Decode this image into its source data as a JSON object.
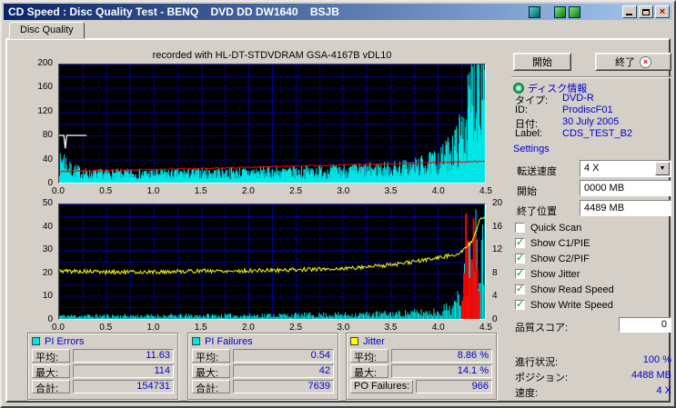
{
  "window": {
    "title": "CD Speed : Disc Quality Test - BENQ    DVD DD DW1640    BSJB"
  },
  "tabs": [
    {
      "label": "Disc Quality"
    }
  ],
  "buttons": {
    "start": "開始",
    "stop": "終了"
  },
  "disc_info": {
    "header": "ディスク情報",
    "rows": [
      {
        "label": "タイプ:",
        "value": "DVD-R"
      },
      {
        "label": "ID:",
        "value": "ProdiscF01"
      },
      {
        "label": "日付:",
        "value": "30 July 2005"
      },
      {
        "label": "Label:",
        "value": "CDS_TEST_B2"
      }
    ]
  },
  "settings": {
    "header": "Settings",
    "speed_label": "転送速度",
    "speed_value": "4 X",
    "start_label": "開始",
    "start_value": "0000 MB",
    "end_label": "終了位置",
    "end_value": "4489 MB",
    "checkboxes": [
      {
        "label": "Quick Scan",
        "checked": false
      },
      {
        "label": "Show C1/PIE",
        "checked": true
      },
      {
        "label": "Show C2/PIF",
        "checked": true
      },
      {
        "label": "Show Jitter",
        "checked": true
      },
      {
        "label": "Show Read Speed",
        "checked": true
      },
      {
        "label": "Show Write Speed",
        "checked": true
      }
    ]
  },
  "quality": {
    "label": "品質スコア:",
    "value": "0"
  },
  "status": [
    {
      "label": "進行状況:",
      "value": "100 %"
    },
    {
      "label": "ポジション:",
      "value": "4488 MB"
    },
    {
      "label": "速度:",
      "value": "4 X"
    }
  ],
  "stats_boxes": [
    {
      "title": "PI Errors",
      "swatch": "#00e6e6",
      "rows": [
        {
          "label": "平均:",
          "value": "11.63"
        },
        {
          "label": "最大:",
          "value": "114"
        },
        {
          "label": "合計:",
          "value": "154731"
        }
      ]
    },
    {
      "title": "PI Failures",
      "swatch": "#00e6e6",
      "rows": [
        {
          "label": "平均:",
          "value": "0.54"
        },
        {
          "label": "最大:",
          "value": "42"
        },
        {
          "label": "合計:",
          "value": "7639"
        }
      ]
    },
    {
      "title": "Jitter",
      "swatch": "#ffff00",
      "rows": [
        {
          "label": "平均:",
          "value": "8.86 %"
        },
        {
          "label": "最大:",
          "value": "14.1 %"
        },
        {
          "label": "PO Failures:",
          "value": "966"
        }
      ]
    }
  ],
  "colors": {
    "titlebar_left": "#0a246a",
    "titlebar_right": "#a6caf0",
    "window_bg": "#d4d0c8",
    "plot_bg": "#000000",
    "grid": "#00008c",
    "value_text": "#0000cc",
    "check": "#00a000"
  },
  "chart_data": [
    {
      "type": "area",
      "title": "recorded with HL-DT-STDVDRAM GSA-4167B vDL10",
      "x_range": [
        0,
        4.5
      ],
      "y_range": [
        0,
        200
      ],
      "x_ticks": [
        "0.0",
        "0.5",
        "1.0",
        "1.5",
        "2.0",
        "2.5",
        "3.0",
        "3.5",
        "4.0",
        "4.5"
      ],
      "y_ticks": [
        "200",
        "160",
        "120",
        "80",
        "40",
        "0"
      ],
      "grid_x_step": 0.25,
      "grid_y_step": 20,
      "series": [
        {
          "name": "PI Errors",
          "color": "#00e6e6",
          "style": "spikes",
          "seed": 7,
          "step": 0.006,
          "envelope": [
            [
              0,
              25
            ],
            [
              0.04,
              40
            ],
            [
              0.1,
              22
            ],
            [
              0.3,
              14
            ],
            [
              1,
              14
            ],
            [
              1.5,
              15
            ],
            [
              2,
              16
            ],
            [
              2.5,
              17
            ],
            [
              3,
              19
            ],
            [
              3.4,
              21
            ],
            [
              3.7,
              24
            ],
            [
              3.9,
              30
            ],
            [
              4.05,
              38
            ],
            [
              4.2,
              60
            ],
            [
              4.3,
              95
            ],
            [
              4.38,
              150
            ],
            [
              4.43,
              195
            ],
            [
              4.45,
              195
            ]
          ]
        },
        {
          "name": "Write Speed",
          "color": "#ff0000",
          "style": "noisyline",
          "seed": 3,
          "step": 0.01,
          "noise": 1.2,
          "envelope": [
            [
              0,
              19
            ],
            [
              1,
              22
            ],
            [
              2,
              26
            ],
            [
              3,
              30
            ],
            [
              4,
              34
            ],
            [
              4.45,
              36
            ]
          ]
        },
        {
          "name": "Read Speed",
          "color": "#ffffff",
          "style": "line",
          "points": [
            [
              0,
              80
            ],
            [
              0.05,
              80
            ],
            [
              0.065,
              58
            ],
            [
              0.08,
              80
            ],
            [
              0.29,
              80
            ]
          ]
        }
      ]
    },
    {
      "type": "line",
      "x_range": [
        0,
        4.5
      ],
      "y_range": [
        0,
        50
      ],
      "y2_range": [
        0,
        20
      ],
      "x_ticks": [
        "0.0",
        "0.5",
        "1.0",
        "1.5",
        "2.0",
        "2.5",
        "3.0",
        "3.5",
        "4.0",
        "4.5"
      ],
      "y_ticks": [
        "50",
        "40",
        "30",
        "20",
        "10",
        "0"
      ],
      "y2_ticks": [
        "20",
        "16",
        "12",
        "8",
        "4",
        "0"
      ],
      "grid_x_step": 0.25,
      "grid_y_step": 5,
      "series": [
        {
          "name": "PI Failures",
          "color": "#00e6e6",
          "style": "spikes",
          "seed": 11,
          "step": 0.012,
          "envelope": [
            [
              0,
              1.3
            ],
            [
              1,
              1.3
            ],
            [
              2,
              1.5
            ],
            [
              3,
              1.8
            ],
            [
              3.5,
              2.2
            ],
            [
              4,
              3
            ],
            [
              4.2,
              6
            ],
            [
              4.3,
              18
            ],
            [
              4.38,
              30
            ],
            [
              4.45,
              40
            ]
          ]
        },
        {
          "name": "PO Failures",
          "color": "#ff0000",
          "style": "spikelist",
          "spikes": [
            [
              4.26,
              8
            ],
            [
              4.28,
              20
            ],
            [
              4.3,
              46
            ],
            [
              4.32,
              34
            ],
            [
              4.34,
              18
            ],
            [
              4.36,
              26
            ],
            [
              4.38,
              44
            ],
            [
              4.4,
              36
            ],
            [
              4.42,
              22
            ],
            [
              4.44,
              12
            ]
          ]
        },
        {
          "name": "Jitter",
          "color": "#ffff00",
          "style": "noisyline",
          "seed": 5,
          "step": 0.01,
          "noise": 0.35,
          "axis": "y2",
          "envelope": [
            [
              0,
              8.4
            ],
            [
              0.5,
              8.2
            ],
            [
              1,
              8.2
            ],
            [
              1.5,
              8.4
            ],
            [
              2,
              8.4
            ],
            [
              2.5,
              8.6
            ],
            [
              3,
              8.8
            ],
            [
              3.3,
              9.2
            ],
            [
              3.6,
              9.6
            ],
            [
              3.9,
              10.4
            ],
            [
              4.1,
              11
            ],
            [
              4.25,
              11.6
            ],
            [
              4.35,
              13.2
            ],
            [
              4.42,
              16
            ],
            [
              4.45,
              17.6
            ]
          ]
        }
      ]
    }
  ]
}
